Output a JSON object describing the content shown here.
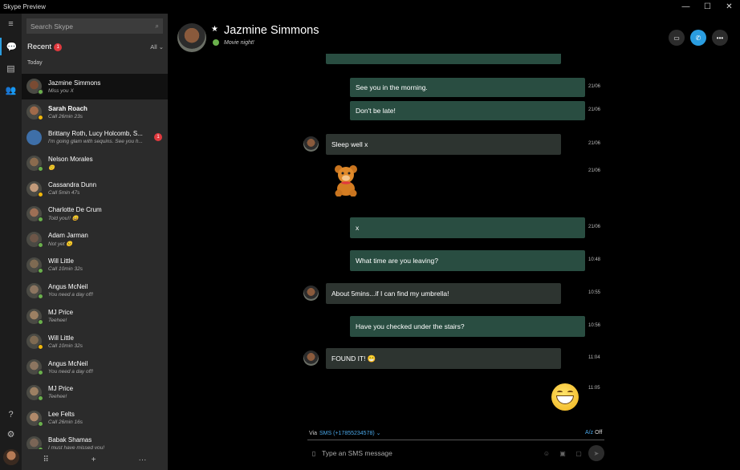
{
  "window": {
    "title": "Skype Preview",
    "minimize": "—",
    "maximize": "☐",
    "close": "✕"
  },
  "rail": {
    "menu_icon": "≡",
    "chats_icon": "💬",
    "contacts_icon": "▤",
    "people_icon": "👥",
    "help_icon": "?",
    "settings_icon": "⚙"
  },
  "search": {
    "placeholder": "Search Skype",
    "icon": "⌕"
  },
  "recent": {
    "label": "Recent",
    "badge": "1",
    "filter": "All ⌄"
  },
  "section_today": "Today",
  "contacts": [
    {
      "name": "Jazmine Simmons",
      "sub": "Miss you X",
      "status": "online",
      "selected": true,
      "bold": false,
      "av": "#7a4b33"
    },
    {
      "name": "Sarah Roach",
      "sub": "Call 26min 23s",
      "status": "away",
      "bold": true,
      "av": "#a06a4a"
    },
    {
      "name": "Brittany Roth, Lucy Holcomb, S...",
      "sub": "I'm going glam with sequins. See you h...",
      "status": "group",
      "badge": "1",
      "av": "#3e6fa8"
    },
    {
      "name": "Nelson Morales",
      "sub": "🙂",
      "status": "online",
      "av": "#8a6b4e"
    },
    {
      "name": "Cassandra Dunn",
      "sub": "Call 5min 47s",
      "status": "away",
      "av": "#c29a7a"
    },
    {
      "name": "Charlotte De Crum",
      "sub": "Told you!! 😄",
      "status": "online",
      "av": "#9d6f55"
    },
    {
      "name": "Adam Jarman",
      "sub": "Not yet 😐",
      "status": "online",
      "av": "#6d5648"
    },
    {
      "name": "Will Little",
      "sub": "Call 10min 32s",
      "status": "online",
      "av": "#7e6a52"
    },
    {
      "name": "Angus McNeil",
      "sub": "You need a day off!",
      "status": "online",
      "av": "#8c7560"
    },
    {
      "name": "MJ Price",
      "sub": "Teehee!",
      "status": "online",
      "av": "#9c8063"
    },
    {
      "name": "Will Little",
      "sub": "Call 10min 32s",
      "status": "away",
      "av": "#7e6a52"
    },
    {
      "name": "Angus McNeil",
      "sub": "You need a day off!",
      "status": "online",
      "av": "#8c7560"
    },
    {
      "name": "MJ Price",
      "sub": "Teehee!",
      "status": "online",
      "av": "#9c8063"
    },
    {
      "name": "Lee Felts",
      "sub": "Call 26min 16s",
      "status": "online",
      "av": "#b0896a"
    },
    {
      "name": "Babak Shamas",
      "sub": "I must have missed you!",
      "status": "online",
      "av": "#7a6556"
    }
  ],
  "panel_bottom": {
    "dialpad_icon": "⠿",
    "add_icon": "+",
    "more_icon": "···"
  },
  "header": {
    "name": "Jazmine Simmons",
    "star": "★",
    "mood": "Movie night!",
    "video_icon": "▭",
    "call_icon": "✆",
    "more_icon": "•••",
    "colors": {
      "call": "#2a9de0",
      "disabled": "#2c2c2c"
    }
  },
  "messages": [
    {
      "dir": "out",
      "text": "See you in the morning.",
      "time": "21/06"
    },
    {
      "dir": "out",
      "text": "Don't be late!",
      "time": "21/06"
    },
    {
      "dir": "in",
      "text": "Sleep well x",
      "time": "21/06"
    },
    {
      "dir": "in",
      "text": "🧸",
      "time": "21/06",
      "sticker": "teddy-bear"
    },
    {
      "dir": "out",
      "text": "x",
      "time": "21/06"
    },
    {
      "dir": "out",
      "text": "What time are you leaving?",
      "time": "10:48"
    },
    {
      "dir": "in",
      "text": "About 5mins...if I can find my umbrella!",
      "time": "10:55"
    },
    {
      "dir": "out",
      "text": "Have you checked under the stairs?",
      "time": "10:56"
    },
    {
      "dir": "in",
      "text": "FOUND IT! 😁",
      "time": "11:04"
    },
    {
      "dir": "out",
      "text": "😁",
      "time": "11:05",
      "sticker": "grin"
    }
  ],
  "compose": {
    "via_label": "Via",
    "via_value": "SMS (+17855234578) ⌄",
    "translate_label": "A/z",
    "translate_state": "Off",
    "placeholder": "Type an SMS message",
    "phone_icon": "▯",
    "emoji_icon": "☺",
    "image_icon": "▣",
    "file_icon": "▢",
    "send_icon": "➤"
  },
  "status_colors": {
    "online": "#6ab04c",
    "away": "#f2b70a",
    "accent": "#2a9de0",
    "badge": "#e0393e"
  }
}
